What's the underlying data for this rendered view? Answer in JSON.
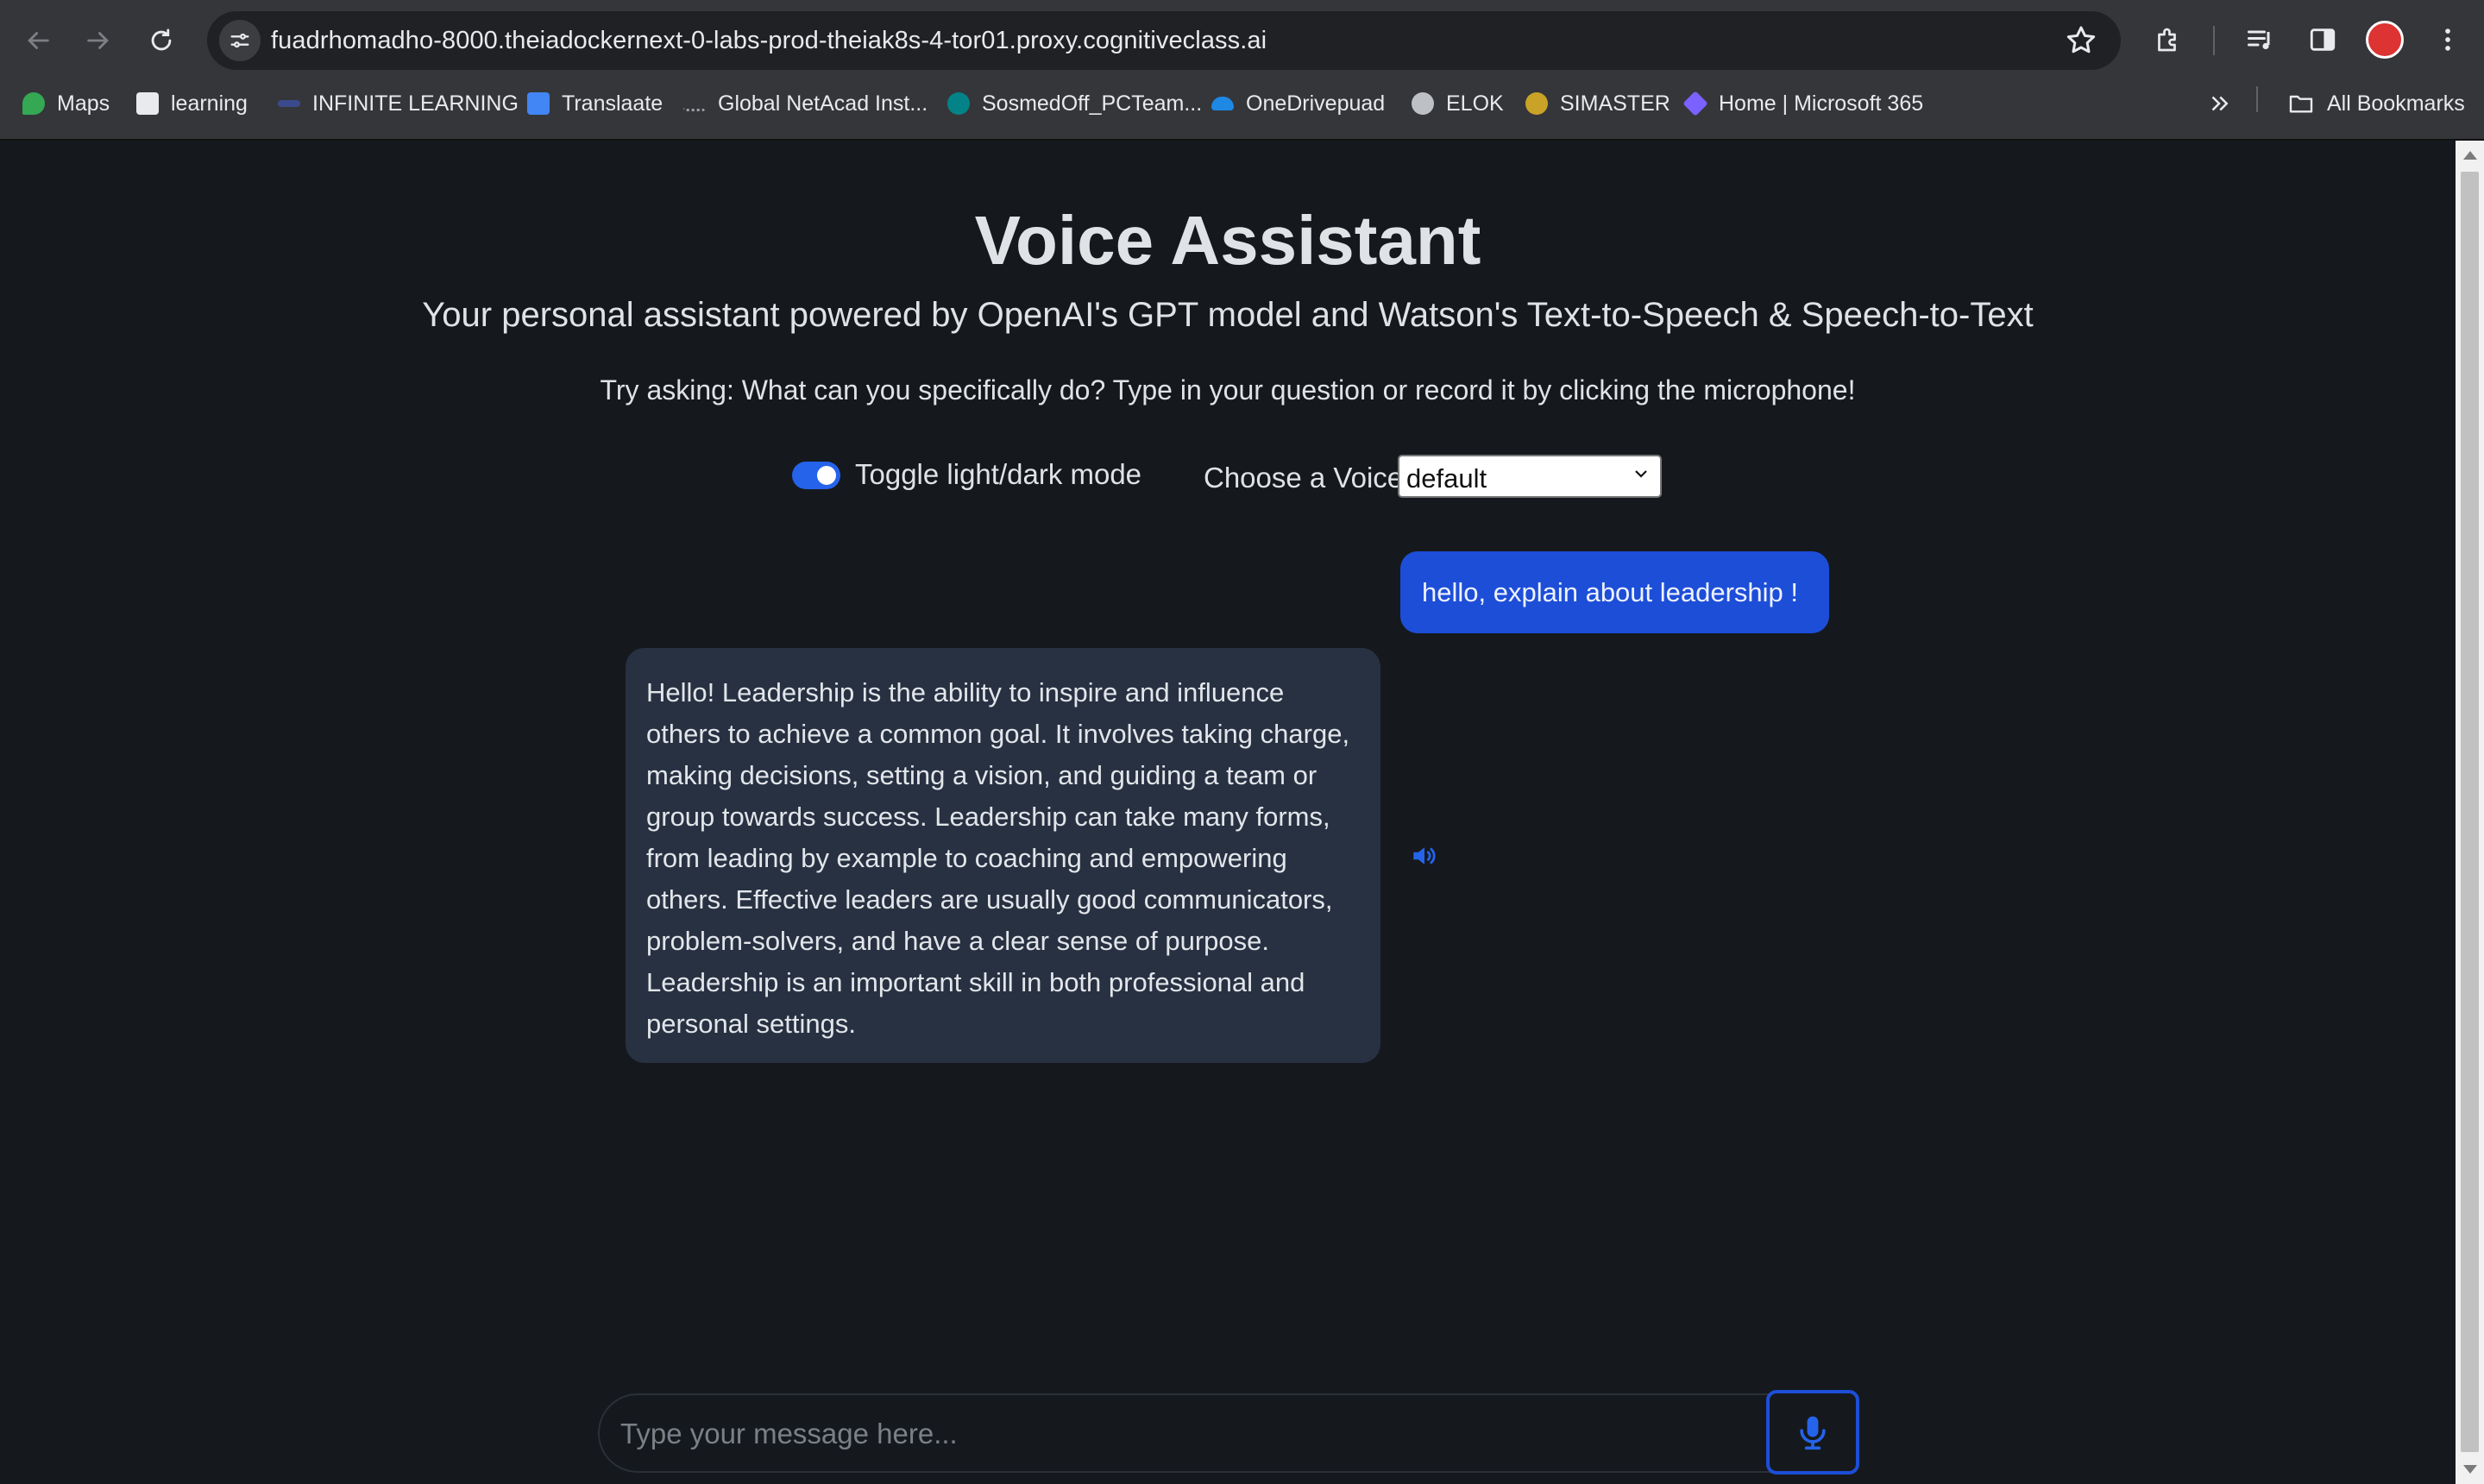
{
  "browser": {
    "url": "fuadrhomadho-8000.theiadockernext-0-labs-prod-theiak8s-4-tor01.proxy.cognitiveclass.ai",
    "bookmarks": [
      {
        "label": "Maps",
        "icon": "maps-pin-icon",
        "color": "#34a853"
      },
      {
        "label": "learning",
        "icon": "learning-favicon",
        "color": "#9aa0a6"
      },
      {
        "label": "INFINITE LEARNING",
        "icon": "infinite-learning-favicon",
        "color": "#3b4a8c"
      },
      {
        "label": "Translaate",
        "icon": "google-translate-icon",
        "color": "#4285f4"
      },
      {
        "label": "Global NetAcad Inst...",
        "icon": "cisco-icon",
        "color": "#9aa0a6"
      },
      {
        "label": "SosmedOff_PCTeam...",
        "icon": "sharepoint-icon",
        "color": "#038387"
      },
      {
        "label": "OneDrivepuad",
        "icon": "onedrive-icon",
        "color": "#0364b8"
      },
      {
        "label": "ELOK",
        "icon": "elok-globe-icon",
        "color": "#bdc1c6"
      },
      {
        "label": "SIMASTER",
        "icon": "simaster-seal-icon",
        "color": "#c9a227"
      },
      {
        "label": "Home | Microsoft 365",
        "icon": "microsoft365-icon",
        "color": "#7b61ff"
      }
    ],
    "all_bookmarks_label": "All Bookmarks"
  },
  "app": {
    "title": "Voice Assistant",
    "subtitle": "Your personal assistant powered by OpenAI's GPT model and Watson's Text-to-Speech & Speech-to-Text",
    "hint": "Try asking: What can you specifically do? Type in your question or record it by clicking the microphone!",
    "toggle_label": "Toggle light/dark mode",
    "toggle_on": true,
    "voice_label": "Choose a Voice",
    "voice_selected": "default"
  },
  "chat": {
    "user_message": "hello, explain about leadership !",
    "assistant_message": "Hello! Leadership is the ability to inspire and influence others to achieve a common goal. It involves taking charge, making decisions, setting a vision, and guiding a team or group towards success. Leadership can take many forms, from leading by example to coaching and empowering others. Effective leaders are usually good communicators, problem-solvers, and have a clear sense of purpose. Leadership is an important skill in both professional and personal settings."
  },
  "composer": {
    "placeholder": "Type your message here..."
  },
  "colors": {
    "accent": "#1d4ed8",
    "page_background": "#15191d",
    "assistant_bubble": "#283142"
  }
}
